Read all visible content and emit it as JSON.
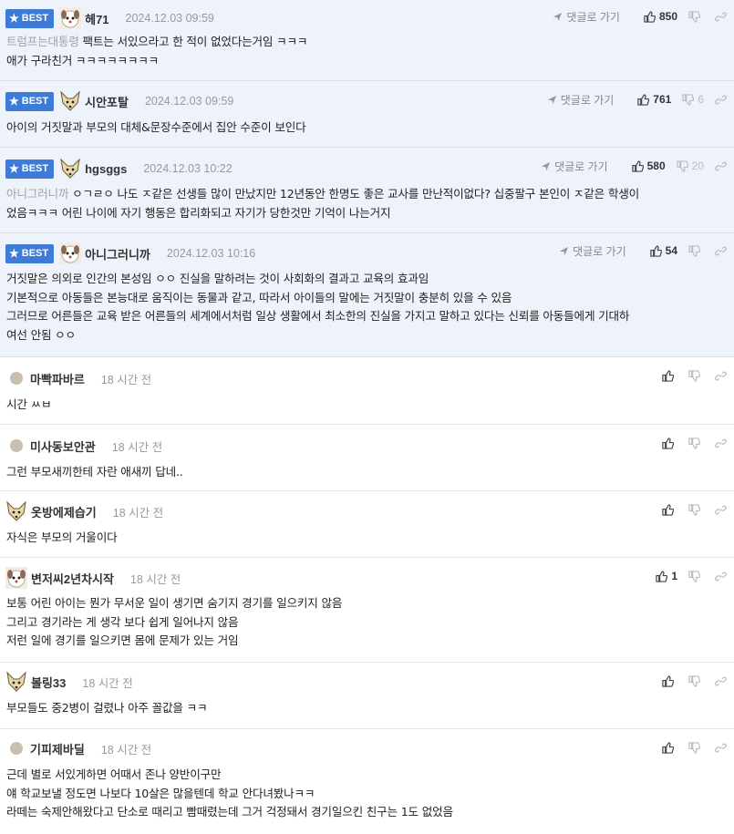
{
  "labels": {
    "best": "BEST",
    "reply": "댓글로 가기"
  },
  "best_comments": [
    {
      "nick": "헤71",
      "time": "2024.12.03 09:59",
      "avatar": "puppy-face-icon",
      "up": "850",
      "down": "",
      "mention": "트럼프는대통령",
      "lines": [
        "팩트는 서있으라고 한 적이 없었다는거임 ㅋㅋㅋ",
        "애가 구라친거 ㅋㅋㅋㅋㅋㅋㅋㅋ"
      ]
    },
    {
      "nick": "시안포탈",
      "time": "2024.12.03 09:59",
      "avatar": "fox-face-icon",
      "up": "761",
      "down": "6",
      "mention": "",
      "lines": [
        "아이의 거짓말과 부모의 대체&문장수준에서 집안 수준이 보인다"
      ]
    },
    {
      "nick": "hgsggs",
      "time": "2024.12.03 10:22",
      "avatar": "fox-face-icon",
      "up": "580",
      "down": "20",
      "mention": "아니그러니까",
      "lines": [
        "ㅇㄱㄹㅇ 나도 ㅈ같은 선생들 많이 만났지만 12년동안 한명도 좋은 교사를 만난적이없다? 십중팔구 본인이 ㅈ같은 학생이",
        "었음ㅋㅋㅋ 어린 나이에 자기 행동은 합리화되고 자기가 당한것만 기억이 나는거지"
      ]
    },
    {
      "nick": "아니그러니까",
      "time": "2024.12.03 10:16",
      "avatar": "puppy-face-icon",
      "up": "54",
      "down": "",
      "mention": "",
      "lines": [
        "거짓말은 의외로 인간의 본성임 ㅇㅇ 진실을 말하려는 것이 사회화의 결과고 교육의 효과임",
        "기본적으로 아동들은 본능대로 움직이는 동물과 같고, 따라서 아이들의 말에는 거짓말이 충분히 있을 수 있음",
        "그러므로 어른들은 교육 받은 어른들의 세계에서처럼 일상 생활에서 최소한의 진실을 가지고 말하고 있다는 신뢰를 아동들에게 기대하",
        "여선 안됨 ㅇㅇ"
      ]
    }
  ],
  "comments": [
    {
      "nick": "마빡파바르",
      "time": "18 시간 전",
      "avatar": "default-dot",
      "up": "",
      "lines": [
        "시간 ㅆㅂ"
      ]
    },
    {
      "nick": "미사동보안관",
      "time": "18 시간 전",
      "avatar": "default-dot",
      "up": "",
      "lines": [
        "그런 부모새끼한테 자란 애새끼 답네.."
      ]
    },
    {
      "nick": "옷방에제습기",
      "time": "18 시간 전",
      "avatar": "fox-face-icon",
      "up": "",
      "lines": [
        "자식은 부모의 거울이다"
      ]
    },
    {
      "nick": "변저씨2년차시작",
      "time": "18 시간 전",
      "avatar": "puppy-face-icon",
      "up": "1",
      "lines": [
        "보통 어린 아이는 뭔가 무서운 일이 생기면 숨기지 경기를 일으키지 않음",
        "그리고 경기라는 게 생각 보다 쉽게 일어나지 않음",
        "저런 일에 경기를 일으키면 몸에 문제가 있는 거임"
      ]
    },
    {
      "nick": "볼링33",
      "time": "18 시간 전",
      "avatar": "fox-face-icon",
      "up": "",
      "lines": [
        "부모들도 중2병이 걸렸나 아주 꼴값을 ㅋㅋ"
      ]
    },
    {
      "nick": "기피제바딜",
      "time": "18 시간 전",
      "avatar": "default-dot",
      "up": "",
      "lines": [
        "근데 별로 서있게하면 어때서 존나 양반이구만",
        "얘 학교보낼 정도면 나보다 10살은 많을텐데 학교 안다녀봤나ㅋㅋ",
        "라떼는 숙제안해왔다고 단소로 때리고 빰때렸는데 그거 걱정돼서 경기일으킨 친구는 1도 없었음"
      ]
    }
  ]
}
